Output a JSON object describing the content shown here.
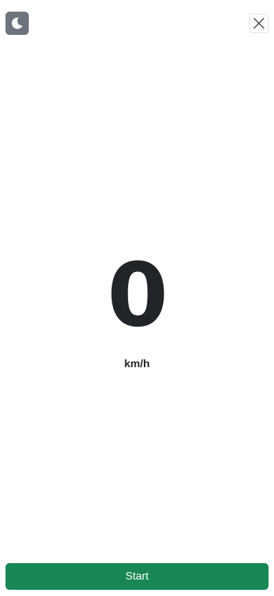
{
  "toolbar": {
    "theme_icon": "moon-icon",
    "close_icon": "close-icon"
  },
  "speed": {
    "value": "0",
    "unit": "km/h"
  },
  "actions": {
    "start_label": "Start"
  },
  "colors": {
    "start_button": "#198754",
    "theme_button": "#6c757d",
    "text": "#212529"
  }
}
